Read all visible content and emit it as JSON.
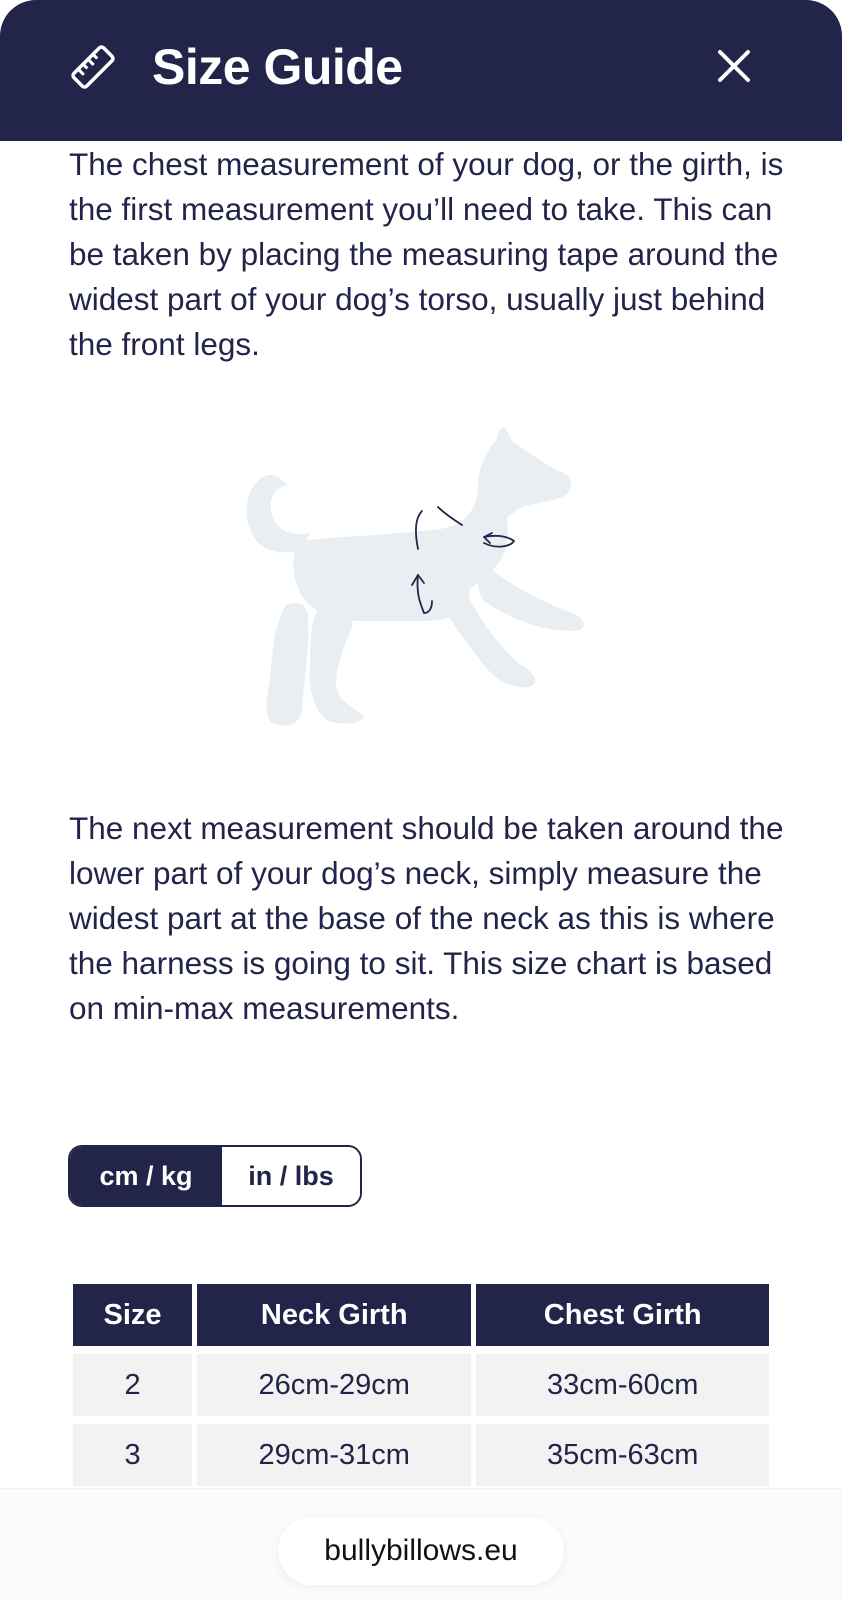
{
  "header": {
    "title": "Size Guide",
    "ruler_icon": "ruler-icon",
    "close_icon": "close-icon"
  },
  "intro_text": "The chest measurement of your dog, or the girth, is the first measurement you’ll need to take. This can be taken by placing the measuring tape around the widest part of your dog’s torso, usually just behind the front legs.",
  "illustration": {
    "icon": "dog-silhouette-with-measure-arrows"
  },
  "second_text": "The next measurement should be taken around the lower part of your dog’s neck, simply measure the widest part at the base of the neck as this is where the harness is going to sit. This size chart is based on min-max measurements.",
  "unit_toggle": {
    "options": [
      "cm / kg",
      "in / lbs"
    ],
    "selected": "cm / kg"
  },
  "size_table": {
    "headers": [
      "Size",
      "Neck Girth",
      "Chest Girth"
    ],
    "rows": [
      [
        "2",
        "26cm-29cm",
        "33cm-60cm"
      ],
      [
        "3",
        "29cm-31cm",
        "35cm-63cm"
      ]
    ]
  },
  "browser": {
    "url": "bullybillows.eu"
  },
  "colors": {
    "primary": "#22244a",
    "cell_bg": "#f2f2f3",
    "illustration": "#e9eef3"
  }
}
